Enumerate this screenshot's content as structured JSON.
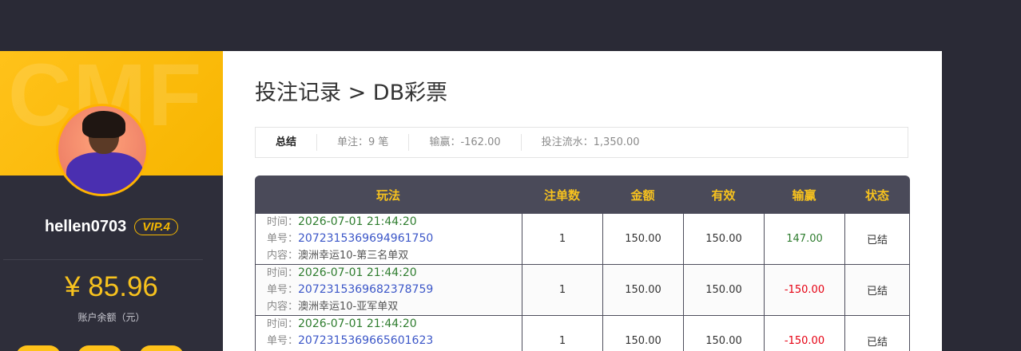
{
  "profile": {
    "banner_watermark": "CMF",
    "username": "hellen0703",
    "vip": "VIP.4",
    "balance": "¥ 85.96",
    "balance_label": "账户余额（元）"
  },
  "page": {
    "title": "投注记录 > DB彩票"
  },
  "summary": {
    "heading": "总结",
    "orders_label": "单注：",
    "orders_value": "9 笔",
    "winloss_label": "输赢：",
    "winloss_value": "-162.00",
    "turnover_label": "投注流水：",
    "turnover_value": "1,350.00"
  },
  "table": {
    "columns": [
      "玩法",
      "注单数",
      "金额",
      "有效",
      "输赢",
      "状态"
    ],
    "labels": {
      "time": "时间：",
      "order": "单号：",
      "content": "内容："
    },
    "rows": [
      {
        "time": "2026-07-01 21:44:20",
        "order": "2072315369694961750",
        "content": "澳洲幸运10-第三名单双",
        "count": "1",
        "amount": "150.00",
        "valid": "150.00",
        "winloss": "147.00",
        "status": "已结"
      },
      {
        "time": "2026-07-01 21:44:20",
        "order": "2072315369682378759",
        "content": "澳洲幸运10-亚军单双",
        "count": "1",
        "amount": "150.00",
        "valid": "150.00",
        "winloss": "-150.00",
        "status": "已结"
      },
      {
        "time": "2026-07-01 21:44:20",
        "order": "2072315369665601623",
        "content": "",
        "count": "1",
        "amount": "150.00",
        "valid": "150.00",
        "winloss": "-150.00",
        "status": "已结"
      }
    ]
  },
  "colors": {
    "accent": "#f7c21e",
    "win": "#2f7d2f",
    "lose": "#e60012",
    "link": "#3c57c8"
  }
}
